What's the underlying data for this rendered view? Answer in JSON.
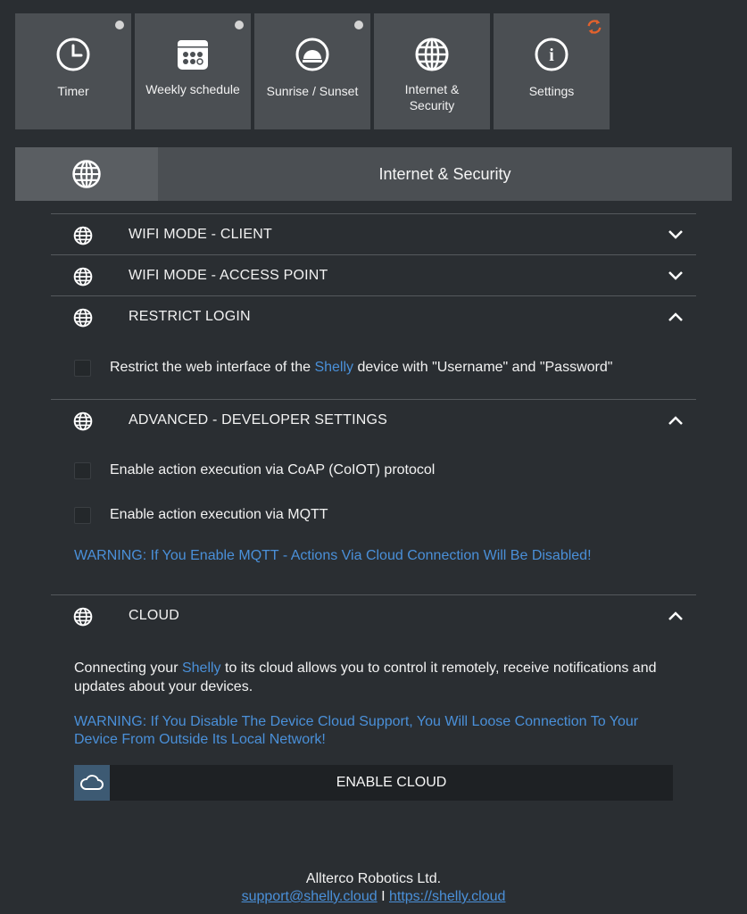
{
  "tiles": [
    {
      "label": "Timer",
      "icon": "clock-icon",
      "indicator": "dot"
    },
    {
      "label": "Weekly schedule",
      "icon": "calendar-icon",
      "indicator": "dot"
    },
    {
      "label": "Sunrise / Sunset",
      "icon": "sunrise-icon",
      "indicator": "dot"
    },
    {
      "label": "Internet & Security",
      "icon": "globe-icon",
      "indicator": "none"
    },
    {
      "label": "Settings",
      "icon": "info-icon",
      "indicator": "refresh"
    }
  ],
  "section": {
    "title": "Internet & Security",
    "icon": "globe-icon"
  },
  "accordion": {
    "wifi_client": {
      "title": "WIFI MODE - CLIENT",
      "expanded": false
    },
    "wifi_ap": {
      "title": "WIFI MODE - ACCESS POINT",
      "expanded": false
    },
    "restrict_login": {
      "title": "RESTRICT LOGIN",
      "expanded": true,
      "checkbox_pre": "Restrict the web interface of the ",
      "checkbox_link": "Shelly",
      "checkbox_post": " device with \"Username\" and \"Password\"",
      "checked": false
    },
    "advanced": {
      "title": "ADVANCED - DEVELOPER SETTINGS",
      "expanded": true,
      "coap_label": "Enable action execution via CoAP (CoIOT) protocol",
      "mqtt_label": "Enable action execution via MQTT",
      "warning": "WARNING: If You Enable MQTT - Actions Via Cloud Connection Will Be Disabled!"
    },
    "cloud": {
      "title": "CLOUD",
      "expanded": true,
      "para_pre": "Connecting your ",
      "para_link": "Shelly",
      "para_post": " to its cloud allows you to control it remotely, receive notifications and updates about your devices.",
      "warning": "WARNING: If You Disable The Device Cloud Support, You Will Loose Connection To Your Device From Outside Its Local Network!",
      "button_label": "ENABLE CLOUD"
    }
  },
  "footer": {
    "company": "Allterco Robotics Ltd.",
    "email": "support@shelly.cloud",
    "separator": " I ",
    "website": "https://shelly.cloud"
  },
  "colors": {
    "background": "#2a2e32",
    "tile": "#4b4f53",
    "link": "#4a90d9",
    "refresh": "#e2622d"
  }
}
